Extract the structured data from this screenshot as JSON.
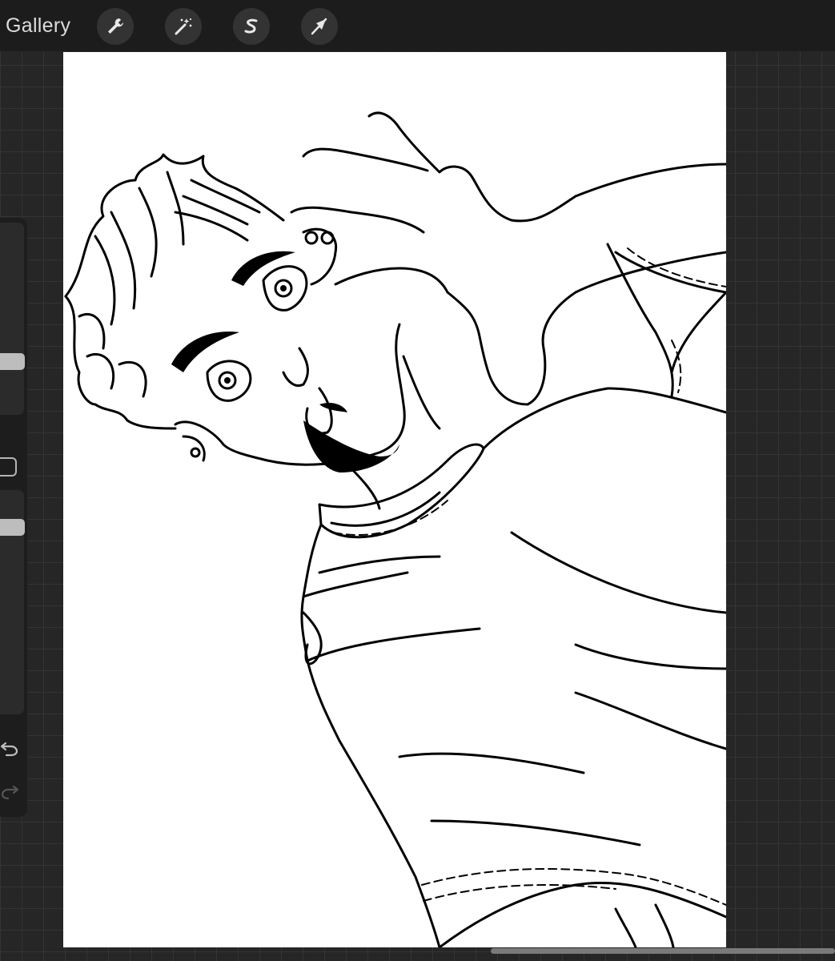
{
  "topbar": {
    "gallery_label": "Gallery",
    "tools": [
      {
        "name": "actions",
        "icon": "wrench-icon"
      },
      {
        "name": "adjustments",
        "icon": "magic-wand-icon"
      },
      {
        "name": "selection",
        "icon": "selection-s-icon"
      },
      {
        "name": "transform",
        "icon": "arrow-cursor-icon"
      }
    ]
  },
  "sidebar": {
    "brush_size_level": 0.7,
    "opacity_level": 0.15,
    "icons": [
      "undo-icon",
      "redo-icon"
    ]
  },
  "colors": {
    "ui_background": "#262626",
    "toolbar": "#1c1c1c",
    "canvas": "#ffffff",
    "ink": "#000000"
  }
}
